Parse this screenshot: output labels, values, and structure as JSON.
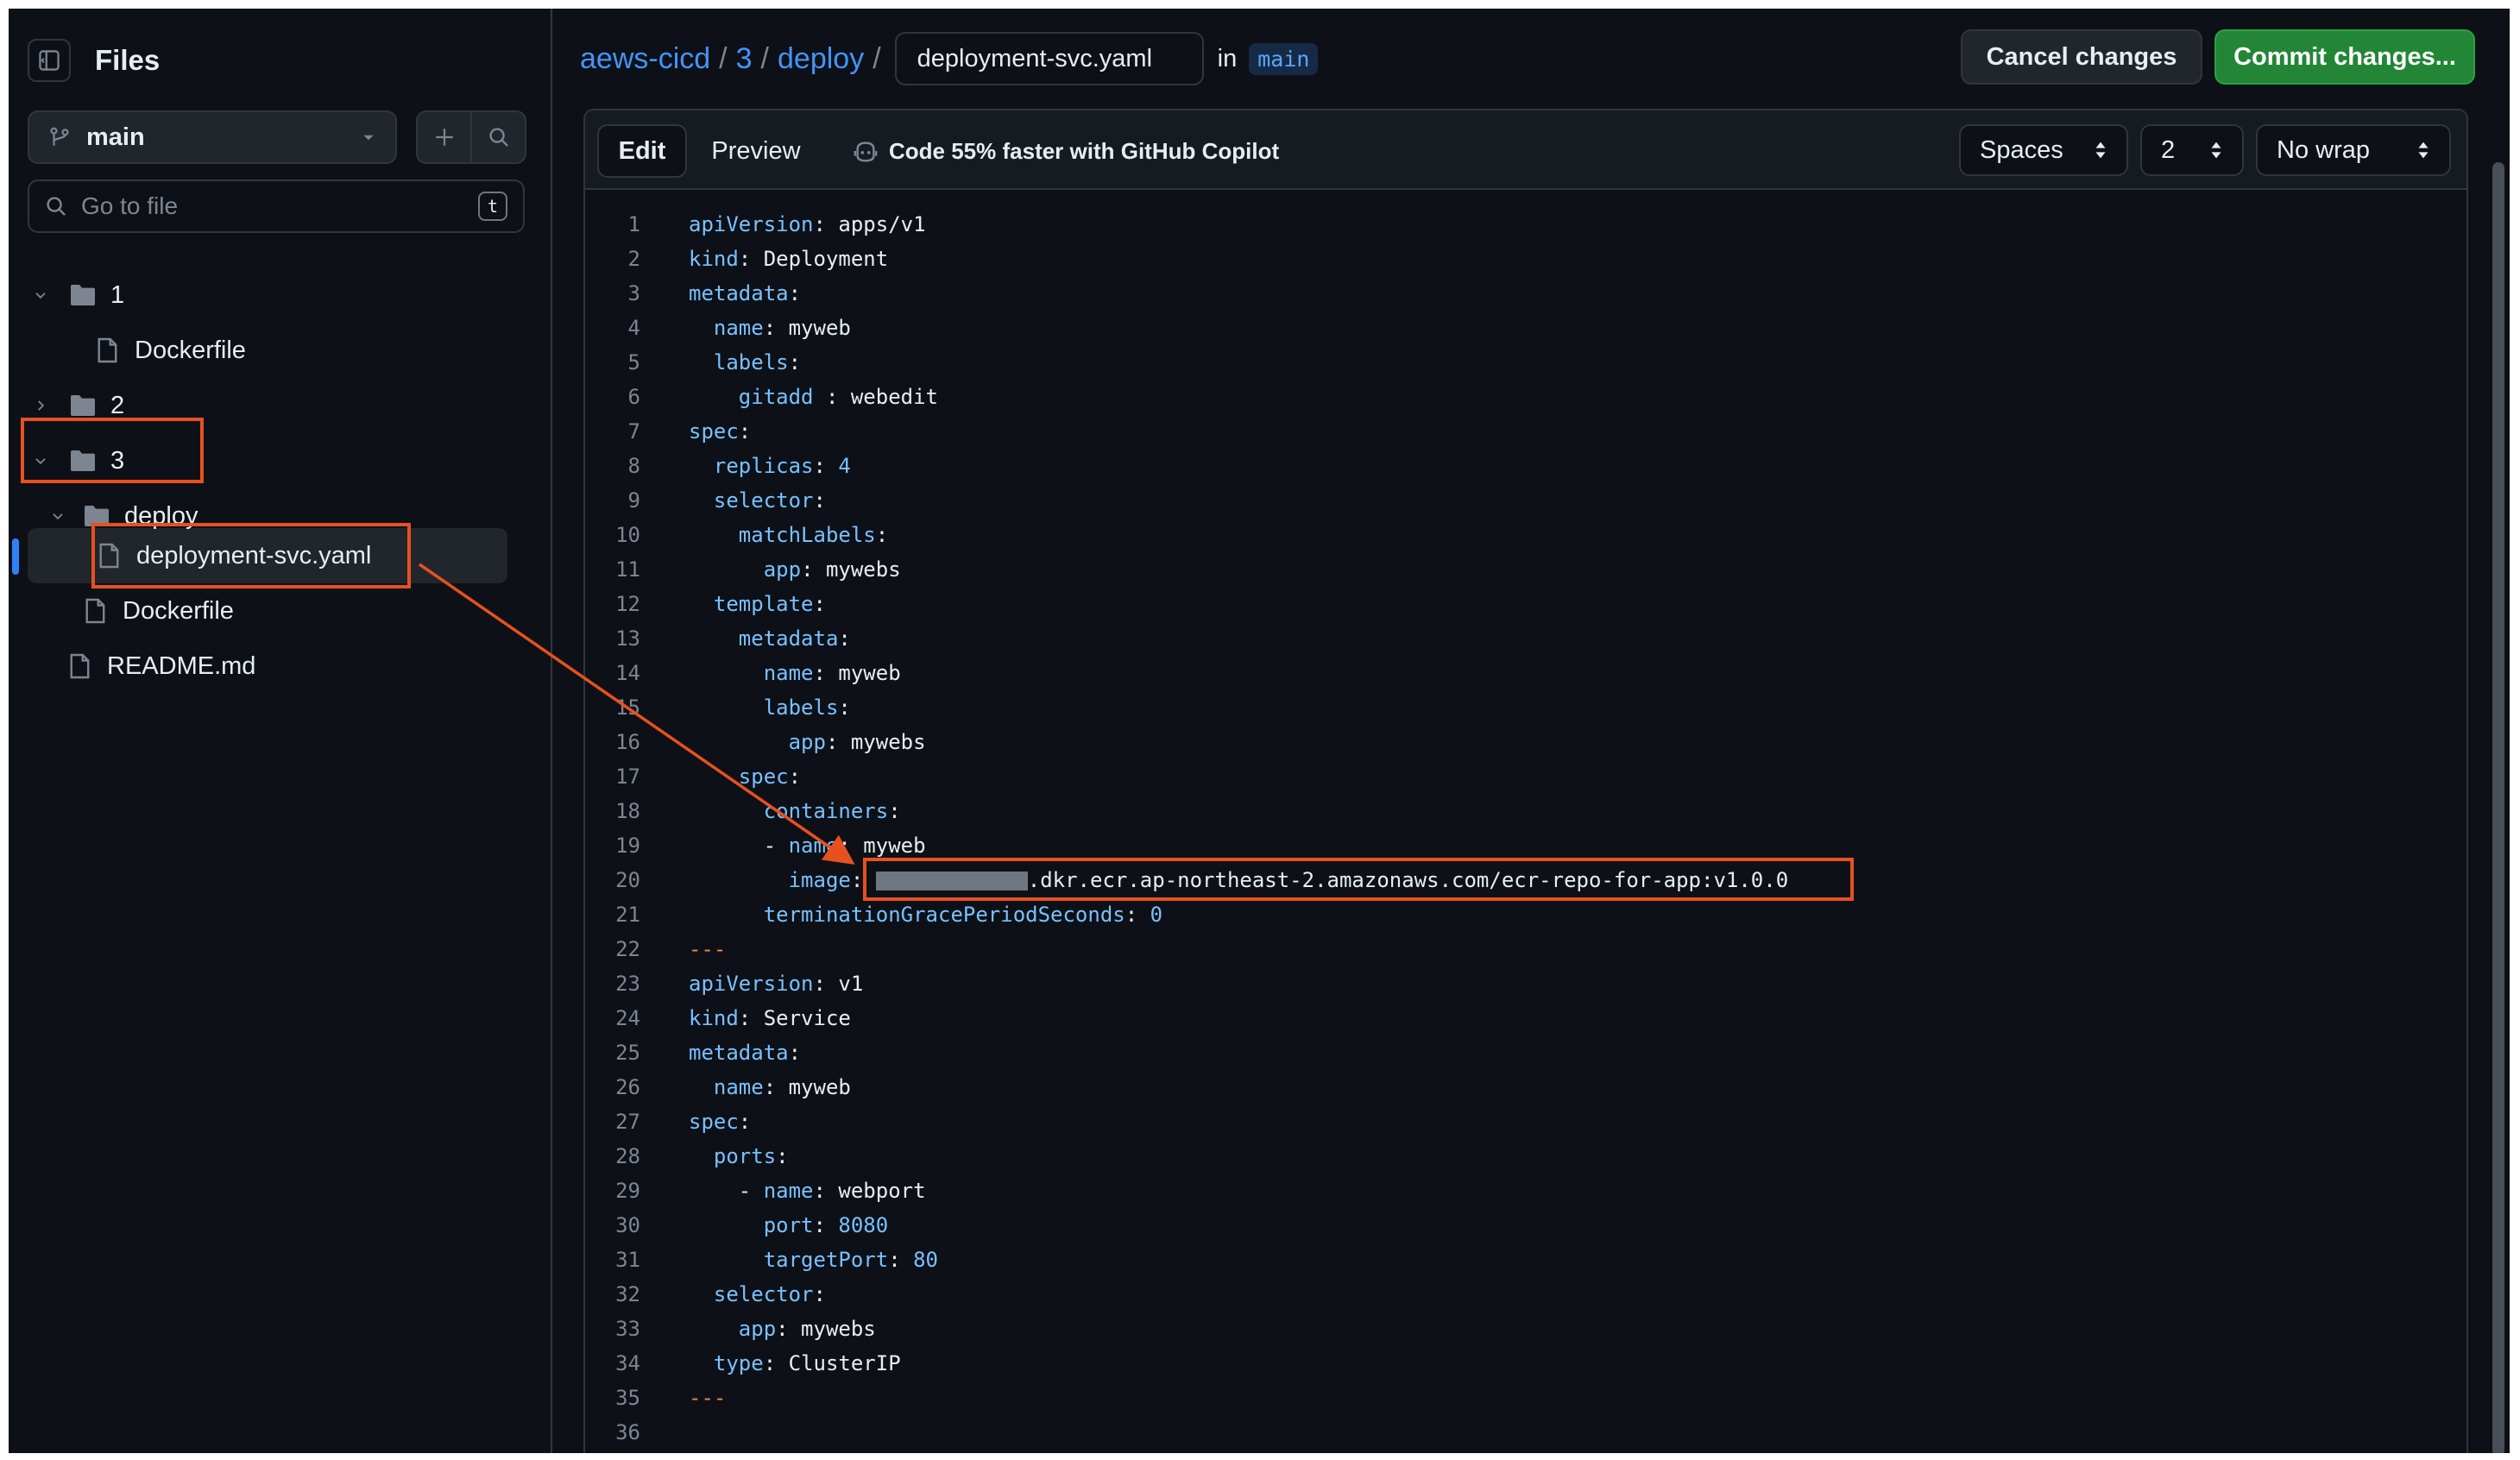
{
  "sidebar": {
    "title": "Files",
    "branch": "main",
    "search_placeholder": "Go to file",
    "search_shortcut": "t",
    "tree": [
      {
        "label": "1",
        "type": "folder",
        "expanded": true
      },
      {
        "label": "Dockerfile",
        "type": "file"
      },
      {
        "label": "2",
        "type": "folder",
        "expanded": false
      },
      {
        "label": "3",
        "type": "folder",
        "expanded": true
      },
      {
        "label": "deploy",
        "type": "folder",
        "expanded": true
      },
      {
        "label": "deployment-svc.yaml",
        "type": "file",
        "selected": true
      },
      {
        "label": "Dockerfile",
        "type": "file"
      },
      {
        "label": "README.md",
        "type": "file"
      }
    ]
  },
  "header": {
    "repo": "aews-cicd",
    "folder": "3",
    "subfolder": "deploy",
    "filename": "deployment-svc.yaml",
    "in_label": "in",
    "branch": "main",
    "cancel_label": "Cancel changes",
    "commit_label": "Commit changes..."
  },
  "editor": {
    "tab_edit": "Edit",
    "tab_preview": "Preview",
    "copilot_text": "Code 55% faster with GitHub Copilot",
    "indent_mode": "Spaces",
    "indent_size": "2",
    "wrap_mode": "No wrap"
  },
  "code_lines": [
    "apiVersion: apps/v1",
    "kind: Deployment",
    "metadata:",
    "  name: myweb",
    "  labels:",
    "    gitadd : webedit",
    "spec:",
    "  replicas: 4",
    "  selector:",
    "    matchLabels:",
    "      app: mywebs",
    "  template:",
    "    metadata:",
    "      name: myweb",
    "      labels:",
    "        app: mywebs",
    "    spec:",
    "      containers:",
    "      - name: myweb",
    "        image: .dkr.ecr.ap-northeast-2.amazonaws.com/ecr-repo-for-app:v1.0.0",
    "      terminationGracePeriodSeconds: 0",
    "---",
    "apiVersion: v1",
    "kind: Service",
    "metadata:",
    "  name: myweb",
    "spec:",
    "  ports:",
    "    - name: webport",
    "      port: 8080",
    "      targetPort: 80",
    "  selector:",
    "    app: mywebs",
    "  type: ClusterIP",
    "---",
    ""
  ],
  "colors": {
    "background": "#0d1117",
    "accent": "#4493f8",
    "commit": "#238636",
    "annotation": "#e8501f",
    "yaml_key": "#79c0ff"
  }
}
